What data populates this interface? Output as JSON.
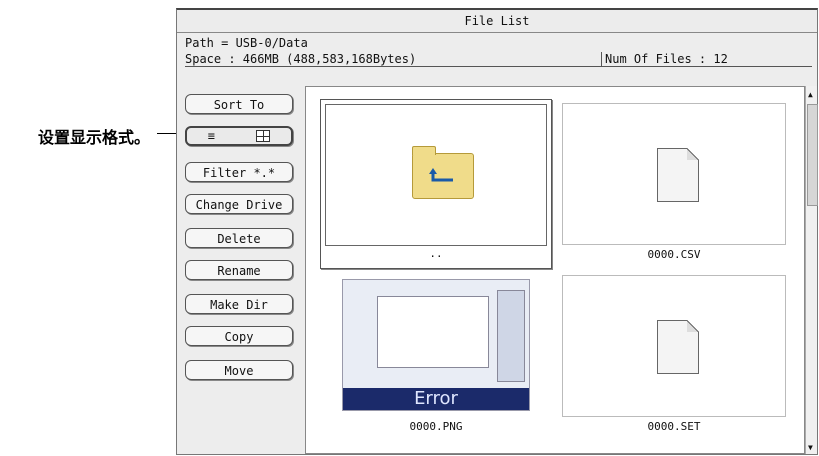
{
  "callout": {
    "text": "设置显示格式。"
  },
  "window": {
    "title": "File List"
  },
  "info": {
    "path": "Path = USB-0/Data",
    "space": "Space : 466MB (488,583,168Bytes)",
    "num_files": "Num Of Files : 12"
  },
  "buttons": {
    "sort": "Sort To",
    "display_list_glyph": "≡",
    "filter": "Filter  *.*",
    "change_drive": "Change Drive",
    "delete": "Delete",
    "rename": "Rename",
    "make_dir": "Make Dir",
    "copy": "Copy",
    "move": "Move"
  },
  "files": [
    {
      "name": "..",
      "icon": "folder-up-icon"
    },
    {
      "name": "0000.CSV",
      "icon": "file-icon"
    },
    {
      "name": "0000.PNG",
      "icon": "image-thumbnail"
    },
    {
      "name": "0000.SET",
      "icon": "file-icon"
    }
  ],
  "thumbnail": {
    "banner_text": "Error"
  }
}
